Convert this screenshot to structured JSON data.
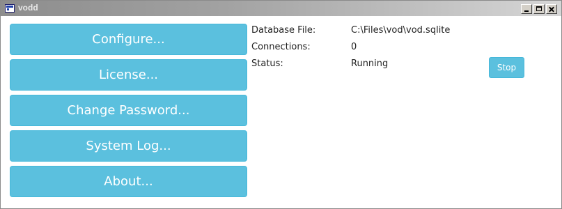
{
  "window": {
    "title": "vodd"
  },
  "icons": {
    "app": "app-window-icon",
    "minimize": "minimize-icon",
    "maximize": "maximize-icon",
    "close": "close-icon"
  },
  "menu": {
    "buttons": [
      {
        "label": "Configure..."
      },
      {
        "label": "License..."
      },
      {
        "label": "Change Password..."
      },
      {
        "label": "System Log..."
      },
      {
        "label": "About..."
      }
    ]
  },
  "info": {
    "rows": [
      {
        "label": "Database File:",
        "value": "C:\\Files\\vod\\vod.sqlite"
      },
      {
        "label": "Connections:",
        "value": "0"
      },
      {
        "label": "Status:",
        "value": "Running"
      }
    ]
  },
  "actions": {
    "stop_label": "Stop"
  },
  "colors": {
    "button_bg": "#5bc0de",
    "button_border": "#46b8da",
    "button_text": "#ffffff"
  }
}
